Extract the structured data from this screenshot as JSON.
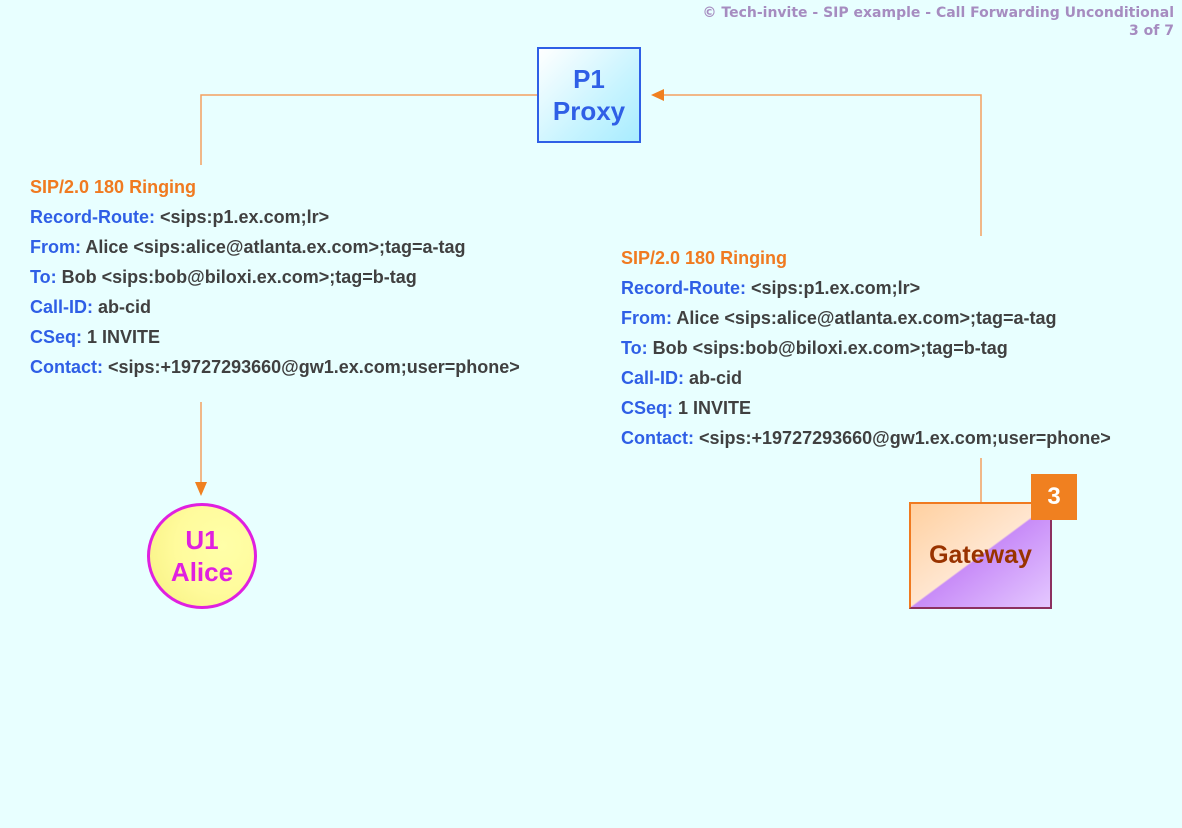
{
  "header": {
    "title": "© Tech-invite - SIP example - Call Forwarding Unconditional",
    "page": "3 of 7"
  },
  "colors": {
    "background": "#e8ffff",
    "arrow": "#f08020",
    "header_name": "#2f5fe6",
    "status_line": "#f07a20",
    "header_value": "#404040",
    "proxy": "#2f5fe6",
    "alice": "#e020e0",
    "gateway_text": "#993300",
    "badge": "#f08020"
  },
  "nodes": {
    "proxy": {
      "line1": "P1",
      "line2": "Proxy"
    },
    "alice": {
      "line1": "U1",
      "line2": "Alice"
    },
    "gateway": {
      "label": "Gateway",
      "step_badge": "3"
    }
  },
  "messages": {
    "left": {
      "status": "SIP/2.0 180 Ringing",
      "headers": [
        {
          "name": "Record-Route",
          "value": " <sips:p1.ex.com;lr>"
        },
        {
          "name": "From",
          "value": " Alice <sips:alice@atlanta.ex.com>;tag=a-tag"
        },
        {
          "name": "To",
          "value": " Bob <sips:bob@biloxi.ex.com>;tag=b-tag"
        },
        {
          "name": "Call-ID",
          "value": " ab-cid"
        },
        {
          "name": "CSeq",
          "value": " 1 INVITE"
        },
        {
          "name": "Contact",
          "value": " <sips:+19727293660@gw1.ex.com;user=phone>"
        }
      ]
    },
    "right": {
      "status": "SIP/2.0 180 Ringing",
      "headers": [
        {
          "name": "Record-Route",
          "value": " <sips:p1.ex.com;lr>"
        },
        {
          "name": "From",
          "value": " Alice <sips:alice@atlanta.ex.com>;tag=a-tag"
        },
        {
          "name": "To",
          "value": " Bob <sips:bob@biloxi.ex.com>;tag=b-tag"
        },
        {
          "name": "Call-ID",
          "value": " ab-cid"
        },
        {
          "name": "CSeq",
          "value": " 1 INVITE"
        },
        {
          "name": "Contact",
          "value": " <sips:+19727293660@gw1.ex.com;user=phone>"
        }
      ]
    }
  }
}
